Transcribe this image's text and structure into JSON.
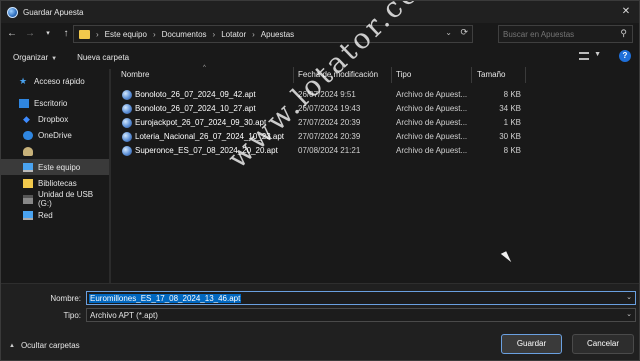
{
  "window": {
    "title": "Guardar Apuesta"
  },
  "navigation": {
    "back_icon": "back-arrow-icon",
    "forward_icon": "forward-arrow-icon",
    "recent_icon": "chevron-down-icon",
    "up_icon": "up-arrow-icon",
    "breadcrumbs": [
      "Este equipo",
      "Documentos",
      "Lotator",
      "Apuestas"
    ],
    "search_placeholder": "Buscar en Apuestas"
  },
  "toolbar": {
    "organize": "Organizar",
    "new_folder": "Nueva carpeta"
  },
  "sidebar": {
    "items": [
      {
        "label": "Acceso rápido",
        "icon": "star-icon"
      },
      {
        "label": "Escritorio",
        "icon": "desktop-icon"
      },
      {
        "label": "Dropbox",
        "icon": "dropbox-icon"
      },
      {
        "label": "OneDrive",
        "icon": "cloud-icon"
      },
      {
        "label": "",
        "icon": "user-folder-icon"
      },
      {
        "label": "Este equipo",
        "icon": "computer-icon"
      },
      {
        "label": "Bibliotecas",
        "icon": "library-icon"
      },
      {
        "label": "Unidad de USB (G:)",
        "icon": "usb-drive-icon"
      },
      {
        "label": "Red",
        "icon": "network-icon"
      }
    ]
  },
  "columns": {
    "name": "Nombre",
    "modified": "Fecha de modificación",
    "type": "Tipo",
    "size": "Tamaño"
  },
  "files": [
    {
      "name": "Bonoloto_26_07_2024_09_42.apt",
      "modified": "26/07/2024 9:51",
      "type": "Archivo de Apuest...",
      "size": "8 KB"
    },
    {
      "name": "Bonoloto_26_07_2024_10_27.apt",
      "modified": "26/07/2024 19:43",
      "type": "Archivo de Apuest...",
      "size": "34 KB"
    },
    {
      "name": "Eurojackpot_26_07_2024_09_30.apt",
      "modified": "27/07/2024 20:39",
      "type": "Archivo de Apuest...",
      "size": "1 KB"
    },
    {
      "name": "Loteria_Nacional_26_07_2024_10_23.apt",
      "modified": "27/07/2024 20:39",
      "type": "Archivo de Apuest...",
      "size": "30 KB"
    },
    {
      "name": "Superonce_ES_07_08_2024_20_20.apt",
      "modified": "07/08/2024 21:21",
      "type": "Archivo de Apuest...",
      "size": "8 KB"
    }
  ],
  "watermark": "www.lotator.com",
  "form": {
    "name_label": "Nombre:",
    "name_value": "Euromillones_ES_17_08_2024_13_46.apt",
    "type_label": "Tipo:",
    "type_value": "Archivo APT (*.apt)"
  },
  "footer": {
    "hide_folders": "Ocultar carpetas",
    "save": "Guardar",
    "cancel": "Cancelar"
  }
}
